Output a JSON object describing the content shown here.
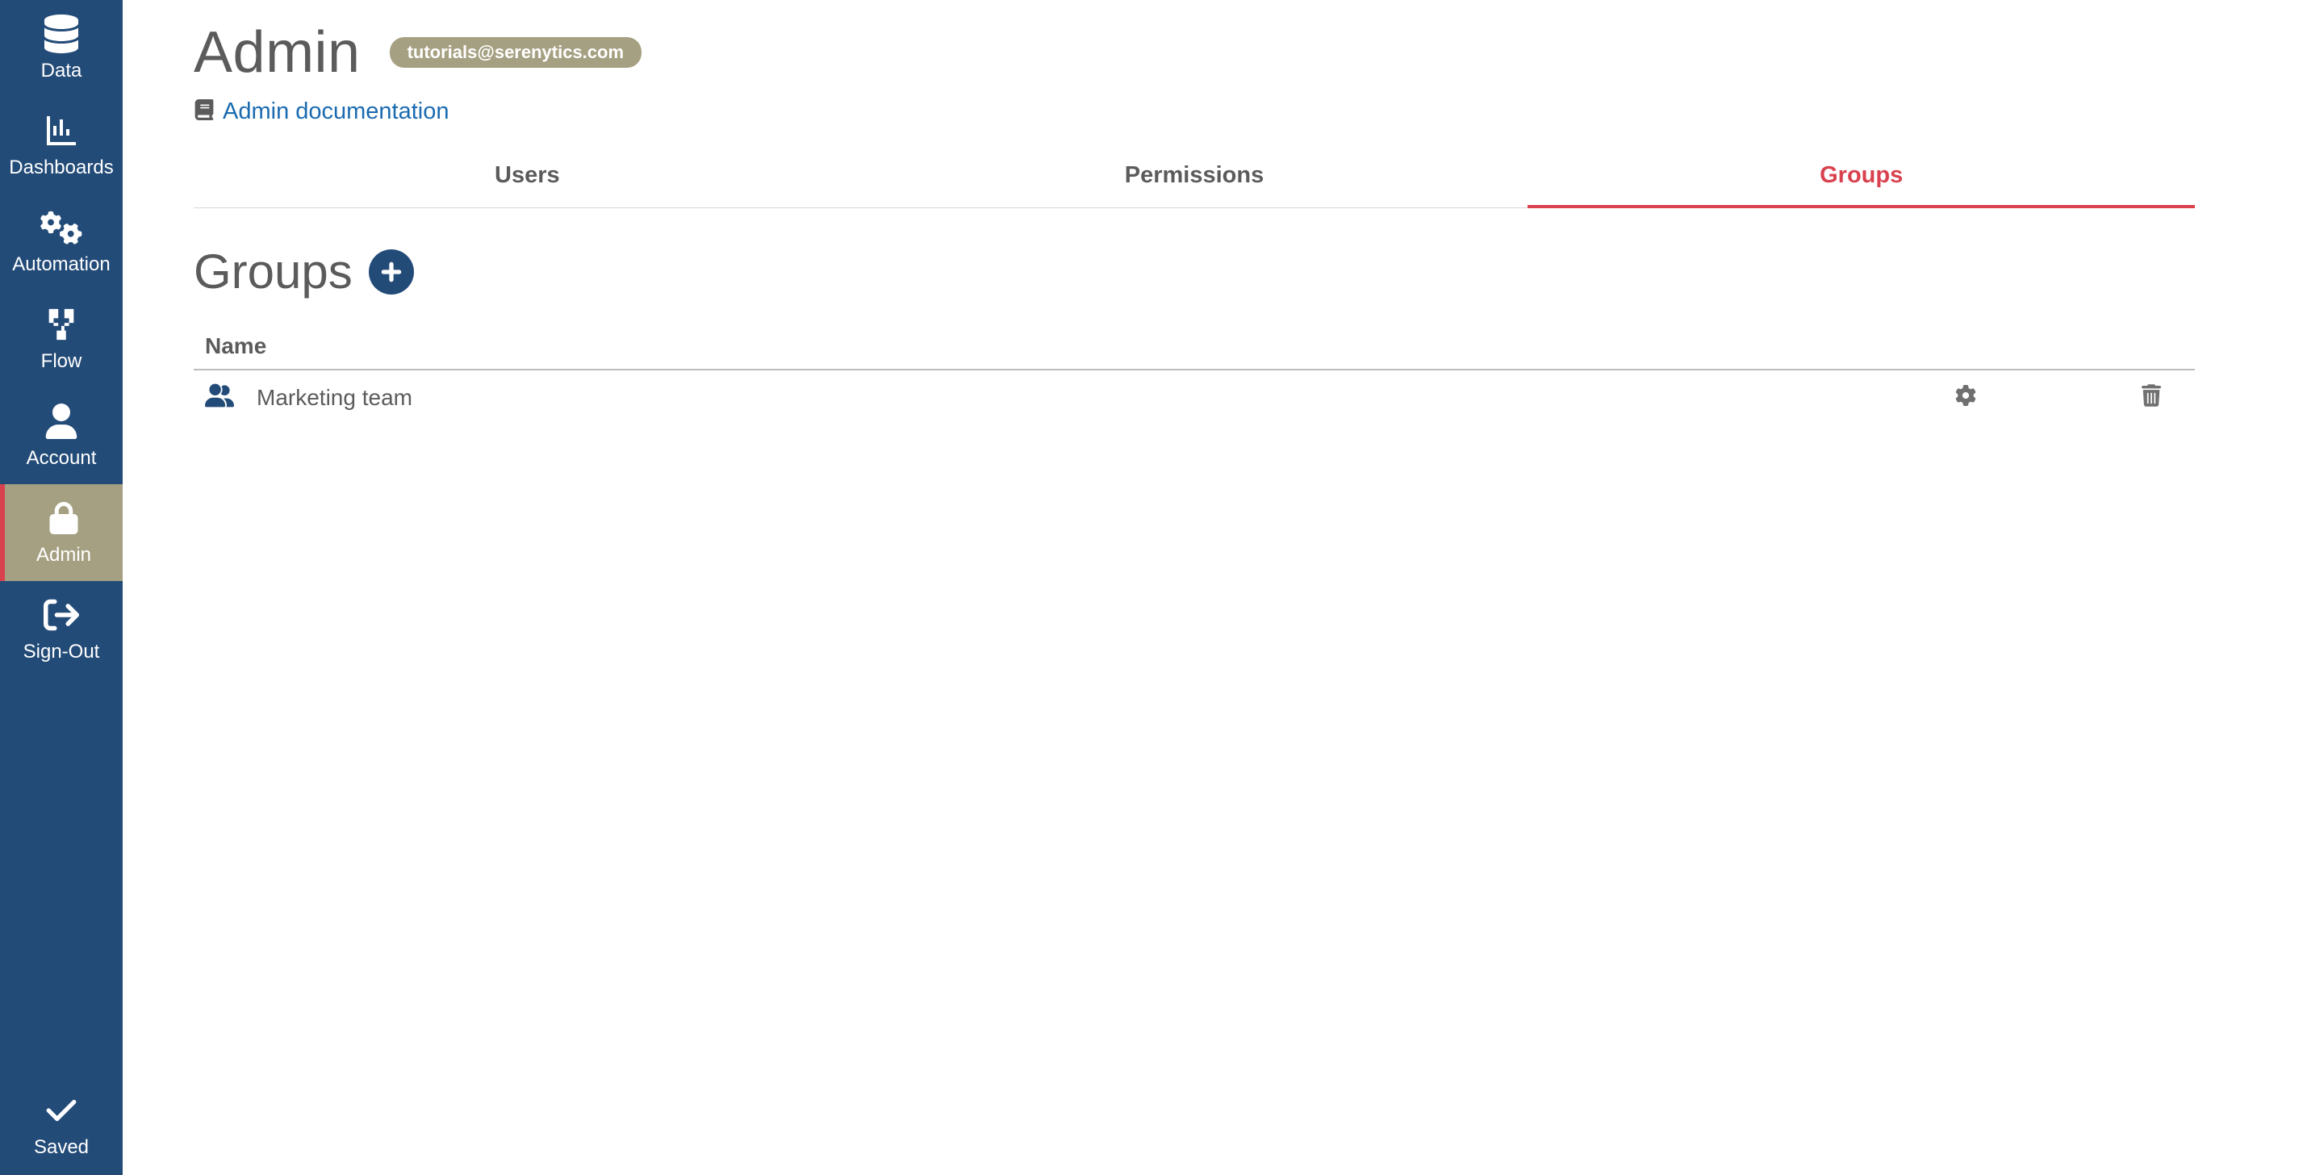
{
  "sidebar": {
    "items": [
      {
        "label": "Data"
      },
      {
        "label": "Dashboards"
      },
      {
        "label": "Automation"
      },
      {
        "label": "Flow"
      },
      {
        "label": "Account"
      },
      {
        "label": "Admin"
      },
      {
        "label": "Sign-Out"
      }
    ],
    "bottom": {
      "label": "Saved"
    }
  },
  "header": {
    "title": "Admin",
    "user_email": "tutorials@serenytics.com",
    "doc_link": "Admin documentation"
  },
  "tabs": [
    {
      "label": "Users"
    },
    {
      "label": "Permissions"
    },
    {
      "label": "Groups"
    }
  ],
  "section": {
    "title": "Groups"
  },
  "table": {
    "header_name": "Name",
    "rows": [
      {
        "name": "Marketing team"
      }
    ]
  }
}
